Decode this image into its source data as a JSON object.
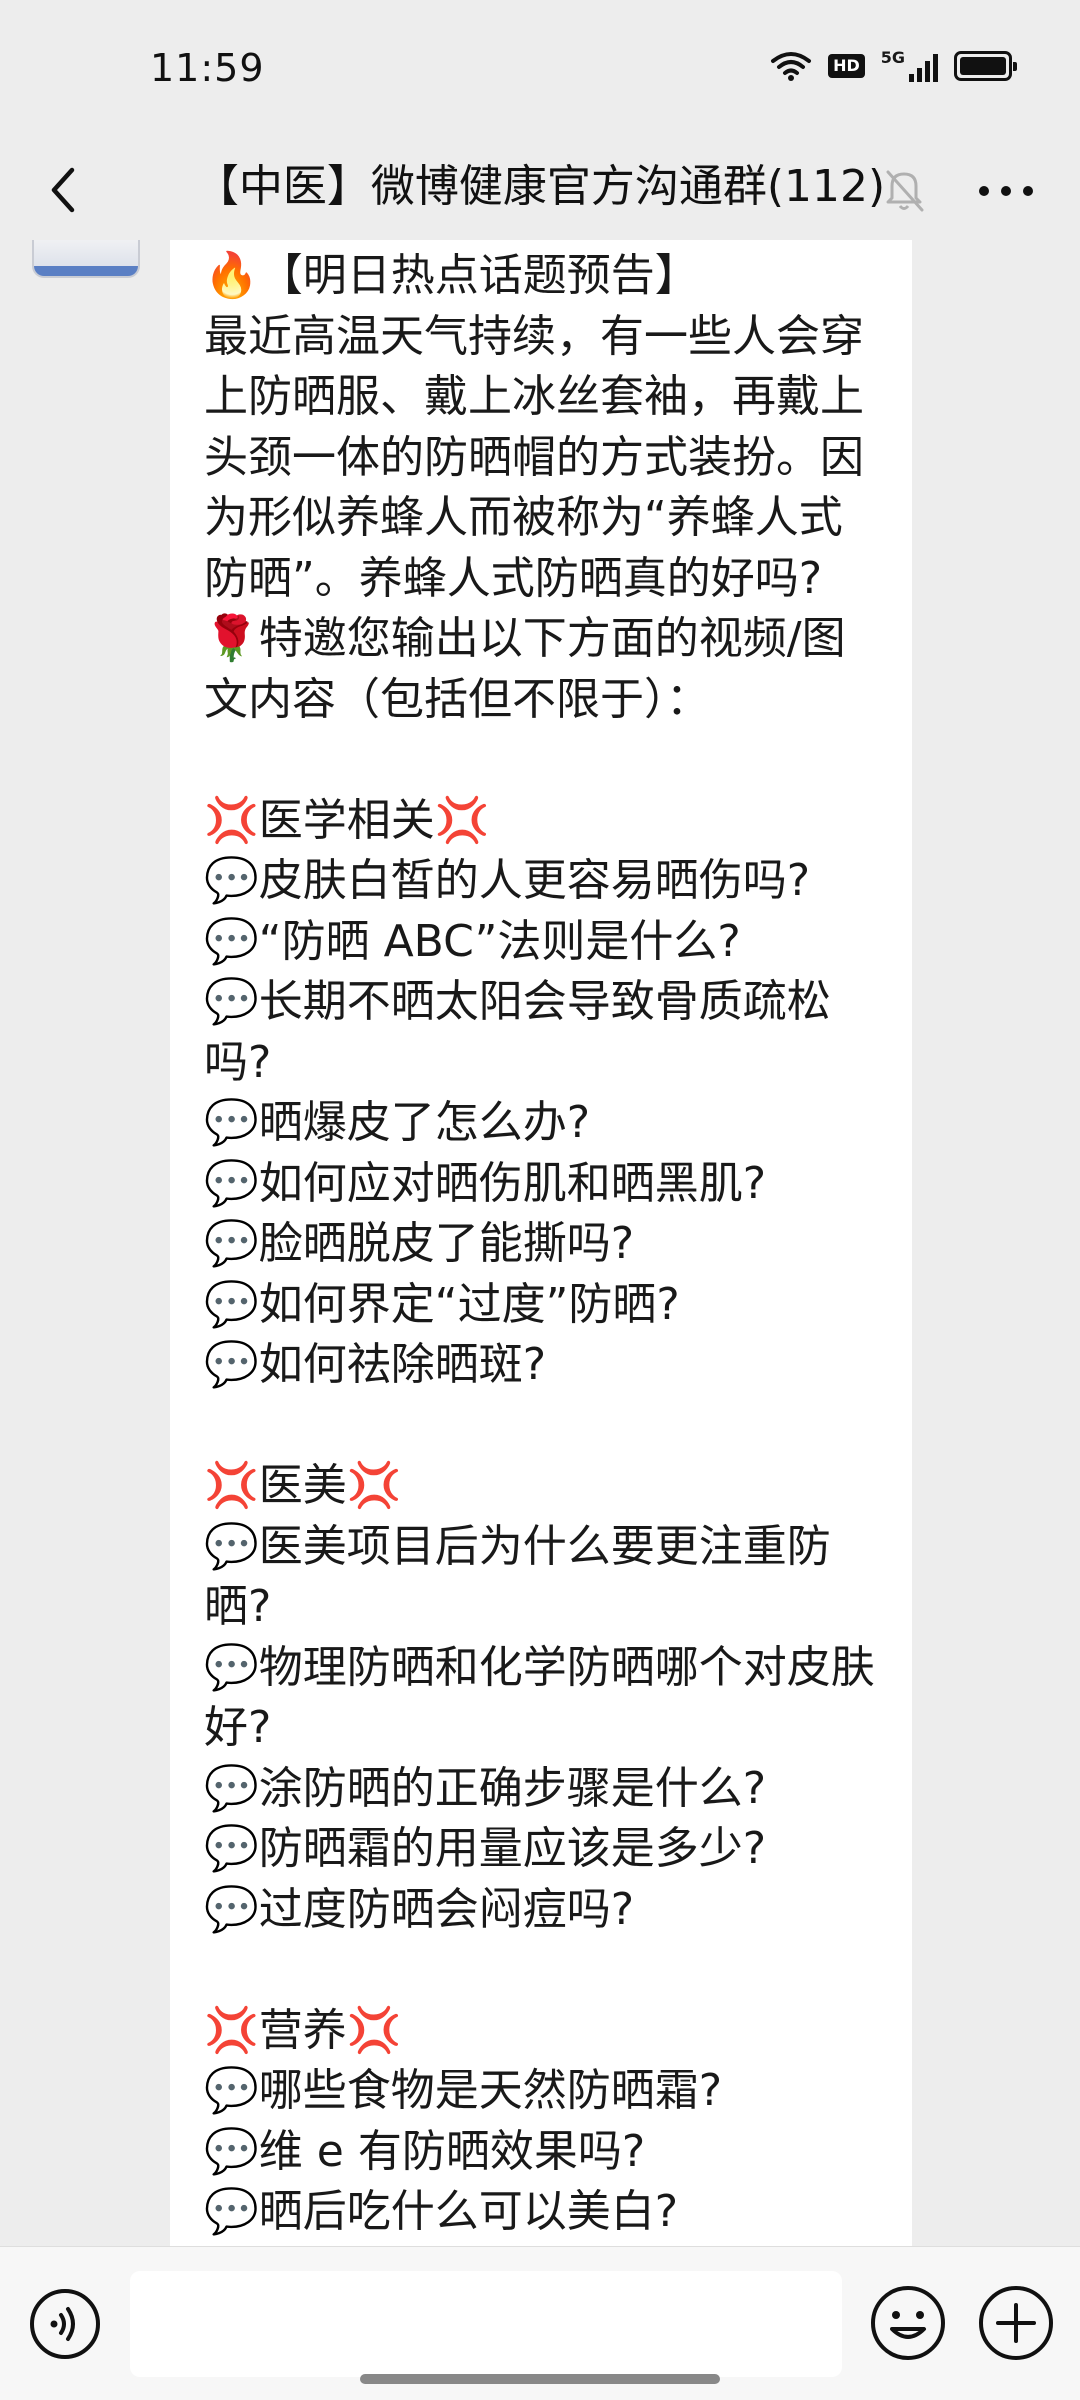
{
  "status_bar": {
    "time": "11:59",
    "hd_badge": "HD",
    "network": "5G"
  },
  "header": {
    "title": "【中医】微博健康官方沟通群(112)"
  },
  "icons": {
    "back": "chevron-left-icon",
    "mute": "bell-off-icon",
    "more": "more-icon",
    "voice": "voice-icon",
    "emoji": "emoji-icon",
    "plus": "plus-icon"
  },
  "message": {
    "lines": [
      "🔥【明日热点话题预告】",
      "最近高温天气持续，有一些人会穿",
      "上防晒服、戴上冰丝套袖，再戴上",
      "头颈一体的防晒帽的方式装扮。因",
      "为形似养蜂人而被称为“养蜂人式",
      "防晒”。养蜂人式防晒真的好吗?",
      "🌹特邀您输出以下方面的视频/图",
      "文内容（包括但不限于）：",
      "",
      "💢医学相关💢",
      "💬皮肤白皙的人更容易晒伤吗?",
      "💬“防晒 ABC”法则是什么?",
      "💬长期不晒太阳会导致骨质疏松",
      "吗?",
      "💬晒爆皮了怎么办?",
      "💬如何应对晒伤肌和晒黑肌?",
      "💬脸晒脱皮了能撕吗?",
      "💬如何界定“过度”防晒?",
      "💬如何祛除晒斑?",
      "",
      "💢医美💢",
      "💬医美项目后为什么要更注重防",
      "晒?",
      "💬物理防晒和化学防晒哪个对皮肤",
      "好?",
      "💬涂防晒的正确步骤是什么?",
      "💬防晒霜的用量应该是多少?",
      "💬过度防晒会闷痘吗?",
      "",
      "💢营养💢",
      "💬哪些食物是天然防晒霜?",
      "💬维 e 有防晒效果吗?",
      "💬晒后吃什么可以美白?"
    ]
  },
  "input": {
    "placeholder": ""
  }
}
